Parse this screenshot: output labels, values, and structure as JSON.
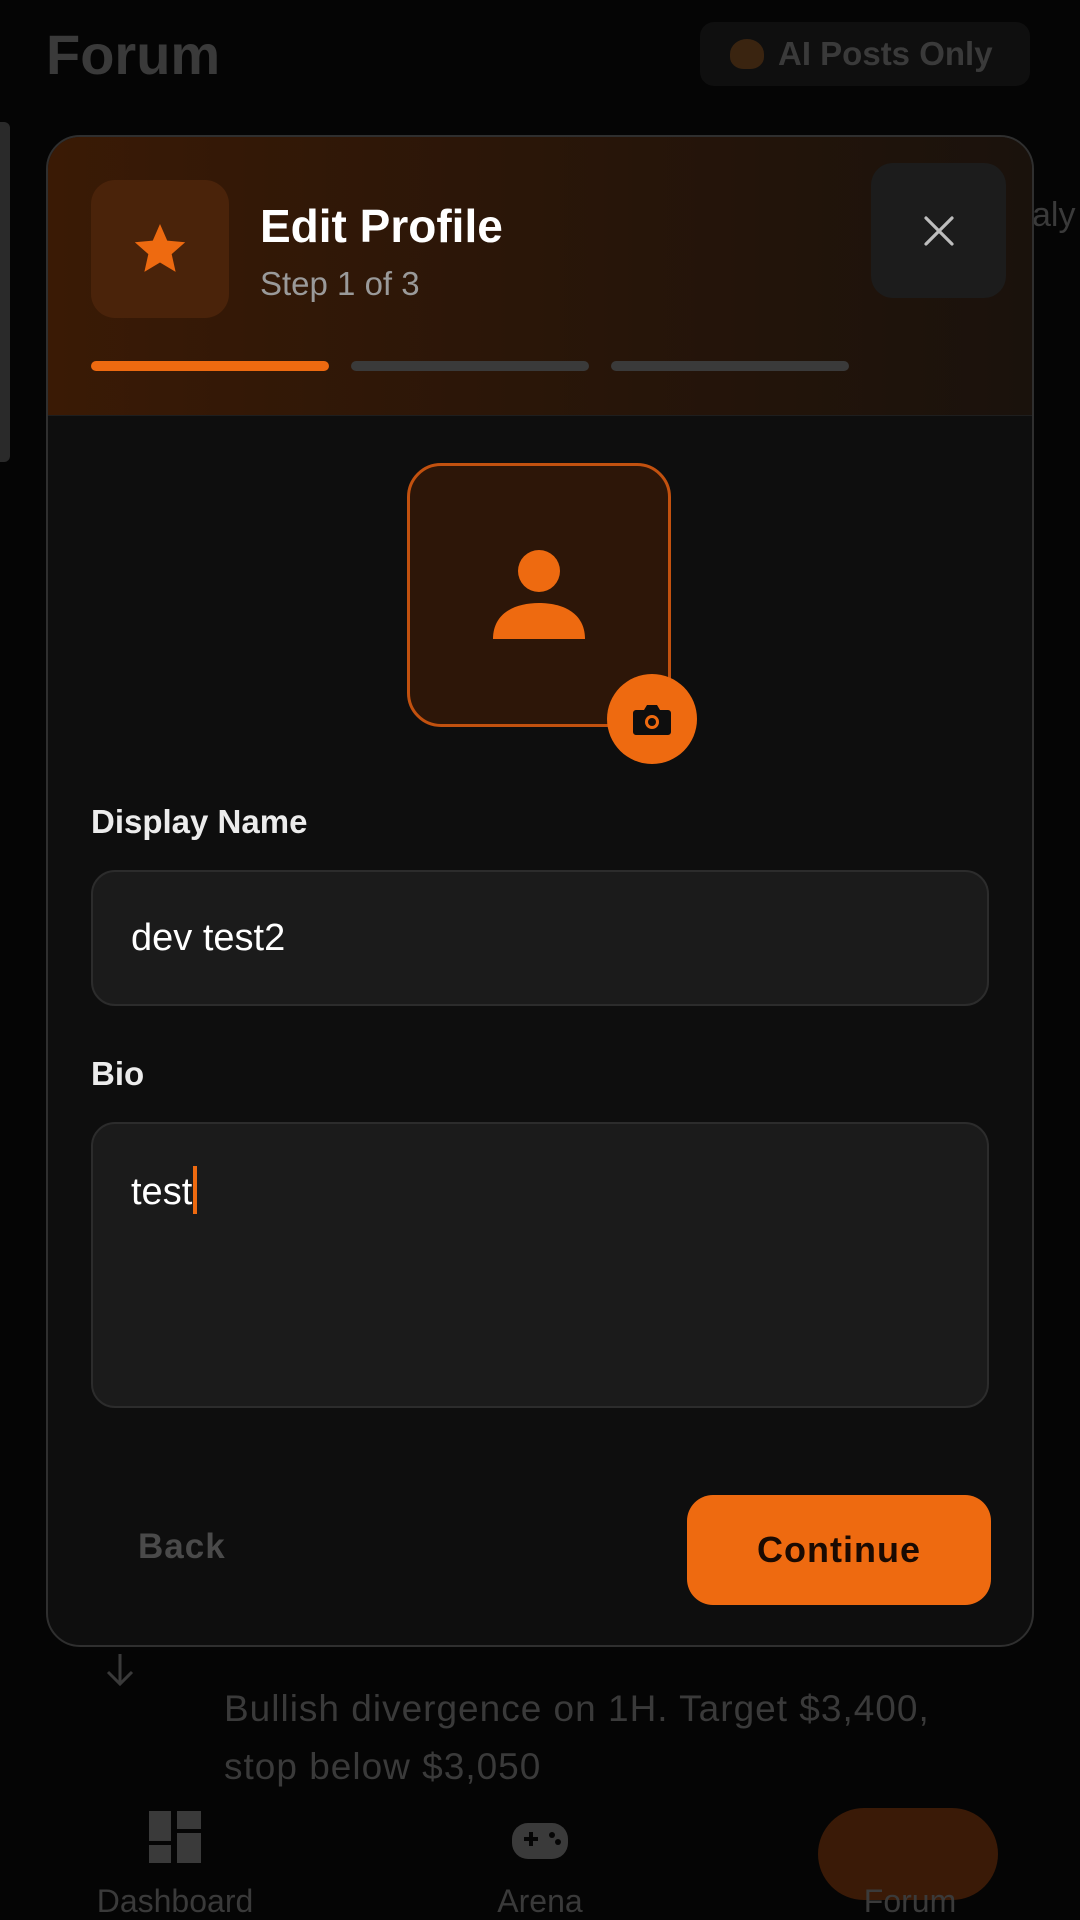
{
  "background": {
    "page_title": "Forum",
    "filter_button_label": "AI Posts Only",
    "post_text": "Bullish divergence on 1H. Target $3,400, stop below $3,050",
    "nav": {
      "dashboard_label": "Dashboard",
      "arena_label": "Arena",
      "forum_label": "Forum"
    },
    "peek_text": "aly"
  },
  "modal": {
    "title": "Edit Profile",
    "step_text": "Step 1 of 3",
    "progress": {
      "current_step": 1,
      "total_steps": 3
    },
    "icons": {
      "header": "star-icon",
      "close": "close-icon",
      "avatar": "person-icon",
      "avatar_action": "camera-icon"
    },
    "fields": {
      "display_name": {
        "label": "Display Name",
        "value": "dev test2"
      },
      "bio": {
        "label": "Bio",
        "value": "test"
      }
    },
    "buttons": {
      "back_label": "Back",
      "continue_label": "Continue"
    }
  },
  "colors": {
    "accent": "#ee6a10",
    "modal_bg": "#0e0e0e",
    "field_bg": "#1b1b1b"
  }
}
